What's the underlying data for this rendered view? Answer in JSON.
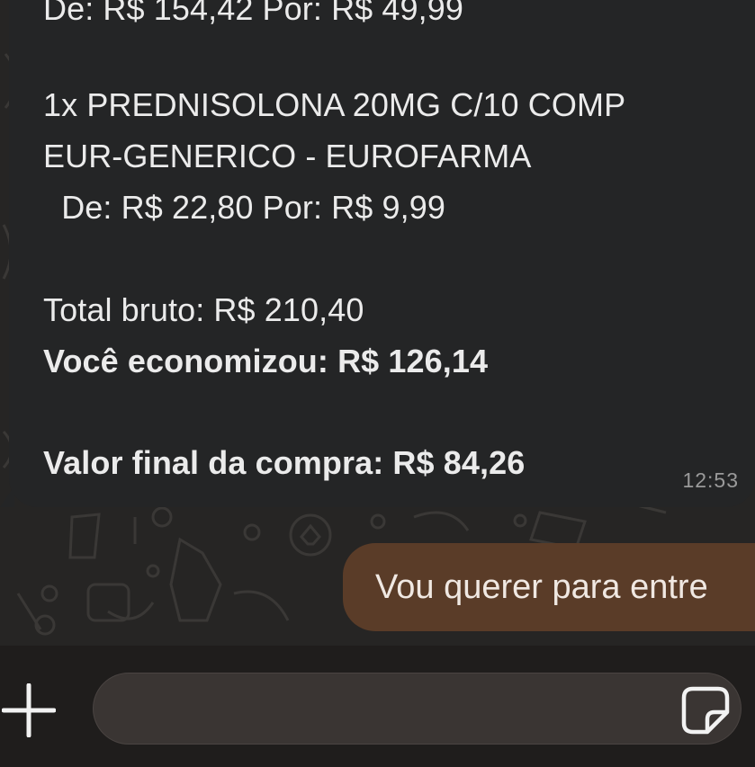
{
  "incoming_message": {
    "lines": [
      "De: R$ 154,42 Por: R$ 49,99",
      "1x PREDNISOLONA 20MG C/10 COMP",
      "EUR-GENERICO - EUROFARMA",
      "  De: R$ 22,80 Por: R$ 9,99",
      "Total bruto: R$ 210,40",
      "Você economizou: R$ 126,14",
      "Valor final da compra: R$ 84,26"
    ],
    "time": "12:53"
  },
  "outgoing_message": {
    "text": "Vou querer para entre"
  },
  "composer": {
    "input_value": "",
    "plus_icon": "plus-icon",
    "sticker_icon": "sticker-icon"
  },
  "colors": {
    "incoming_bubble": "#242526",
    "outgoing_bubble": "#5a3c28",
    "chat_background": "#262524",
    "composer_background": "#1f1d1c"
  }
}
